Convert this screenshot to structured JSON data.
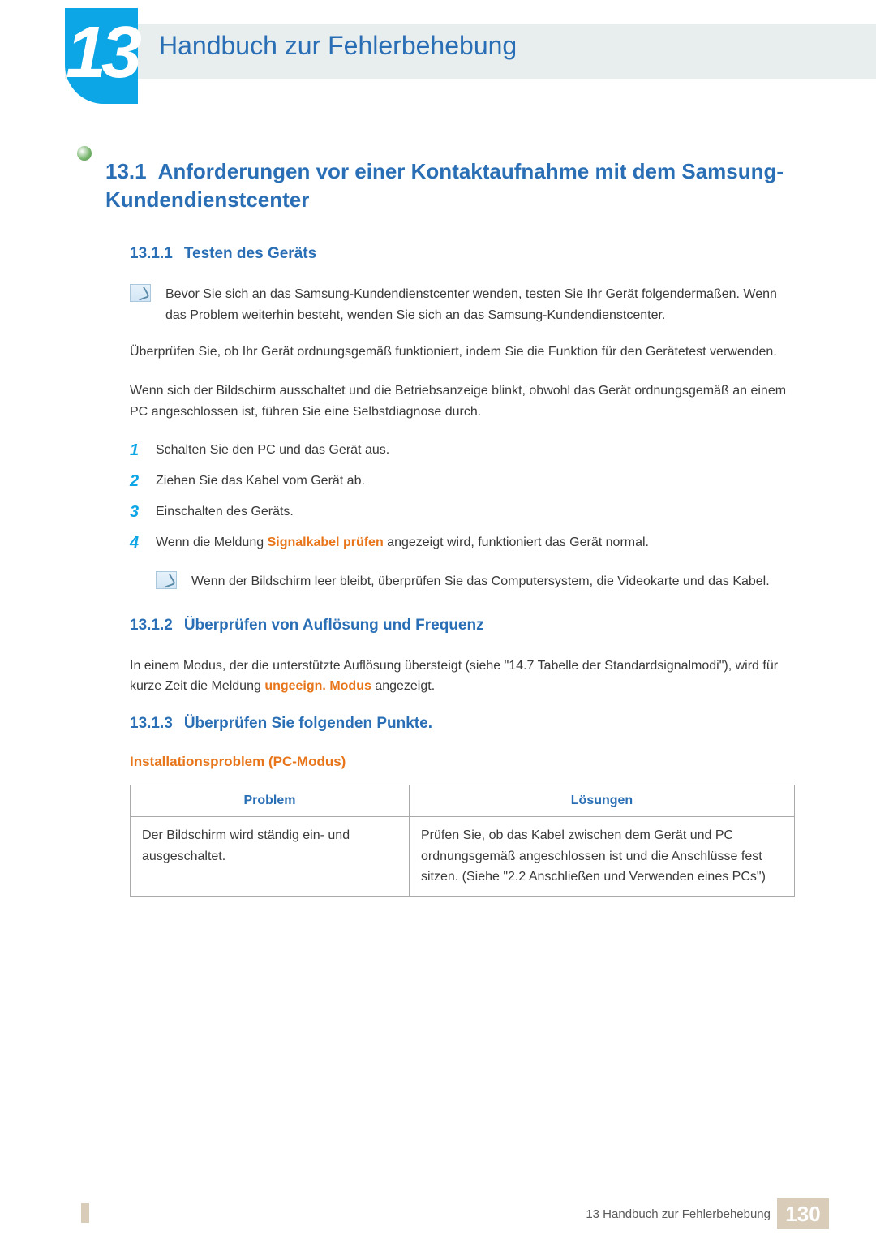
{
  "chapter": {
    "number": "13",
    "title": "Handbuch zur Fehlerbehebung"
  },
  "section": {
    "number": "13.1",
    "title": "Anforderungen vor einer Kontaktaufnahme mit dem Samsung-Kundendienstcenter"
  },
  "sub1": {
    "number": "13.1.1",
    "title": "Testen des Geräts",
    "note": "Bevor Sie sich an das Samsung-Kundendienstcenter wenden, testen Sie Ihr Gerät folgendermaßen. Wenn das Problem weiterhin besteht, wenden Sie sich an das Samsung-Kundendienstcenter.",
    "p1": "Überprüfen Sie, ob Ihr Gerät ordnungsgemäß funktioniert, indem Sie die Funktion für den Gerätetest verwenden.",
    "p2": "Wenn sich der Bildschirm ausschaltet und die Betriebsanzeige blinkt, obwohl das Gerät ordnungsgemäß an einem PC angeschlossen ist, führen Sie eine Selbstdiagnose durch.",
    "steps": [
      "Schalten Sie den PC und das Gerät aus.",
      "Ziehen Sie das Kabel vom Gerät ab.",
      "Einschalten des Geräts.",
      "Wenn die Meldung "
    ],
    "step4_hl": "Signalkabel prüfen",
    "step4_tail": " angezeigt wird, funktioniert das Gerät normal.",
    "nested_note": "Wenn der Bildschirm leer bleibt, überprüfen Sie das Computersystem, die Videokarte und das Kabel."
  },
  "sub2": {
    "number": "13.1.2",
    "title": "Überprüfen von Auflösung und Frequenz",
    "p_pre": "In einem Modus, der die unterstützte Auflösung übersteigt (siehe \"14.7 Tabelle der Standardsignalmodi\"), wird für kurze Zeit die Meldung ",
    "p_hl": "ungeeign. Modus",
    "p_post": " angezeigt."
  },
  "sub3": {
    "number": "13.1.3",
    "title": "Überprüfen Sie folgenden Punkte.",
    "group_title": "Installationsproblem (PC-Modus)",
    "table": {
      "headers": [
        "Problem",
        "Lösungen"
      ],
      "rows": [
        {
          "problem": "Der Bildschirm wird ständig ein- und ausgeschaltet.",
          "solution": "Prüfen Sie, ob das Kabel zwischen dem Gerät und PC ordnungsgemäß angeschlossen ist und die Anschlüsse fest sitzen. (Siehe \"2.2 Anschließen und Verwenden eines PCs\")"
        }
      ]
    }
  },
  "footer": {
    "text": "13 Handbuch zur Fehlerbehebung",
    "page": "130"
  }
}
